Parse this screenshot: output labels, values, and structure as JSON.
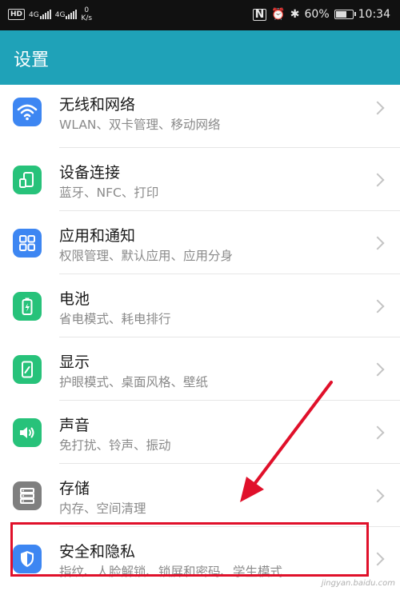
{
  "status_bar": {
    "hd_badge": "HD",
    "network_1": "4G",
    "network_2": "4G",
    "speed_value": "0",
    "speed_unit": "K/s",
    "battery_percent": "60%",
    "time": "10:34"
  },
  "header": {
    "title": "设置"
  },
  "settings_items": [
    {
      "title": "无线和网络",
      "subtitle": "WLAN、双卡管理、移动网络",
      "icon": "wifi-icon",
      "color": "#3d86f2"
    },
    {
      "title": "设备连接",
      "subtitle": "蓝牙、NFC、打印",
      "icon": "device-connection-icon",
      "color": "#27c27a"
    },
    {
      "title": "应用和通知",
      "subtitle": "权限管理、默认应用、应用分身",
      "icon": "apps-icon",
      "color": "#3d86f2"
    },
    {
      "title": "电池",
      "subtitle": "省电模式、耗电排行",
      "icon": "battery-icon",
      "color": "#27c27a"
    },
    {
      "title": "显示",
      "subtitle": "护眼模式、桌面风格、壁纸",
      "icon": "display-icon",
      "color": "#27c27a"
    },
    {
      "title": "声音",
      "subtitle": "免打扰、铃声、振动",
      "icon": "sound-icon",
      "color": "#27c27a"
    },
    {
      "title": "存储",
      "subtitle": "内存、空间清理",
      "icon": "storage-icon",
      "color": "#7f7f7f"
    },
    {
      "title": "安全和隐私",
      "subtitle": "指纹、人脸解锁、锁屏和密码、学生模式",
      "icon": "shield-icon",
      "color": "#3d86f2"
    }
  ],
  "annotation": {
    "highlight_color": "#e0102a"
  },
  "watermark": "jingyan.baidu.com"
}
